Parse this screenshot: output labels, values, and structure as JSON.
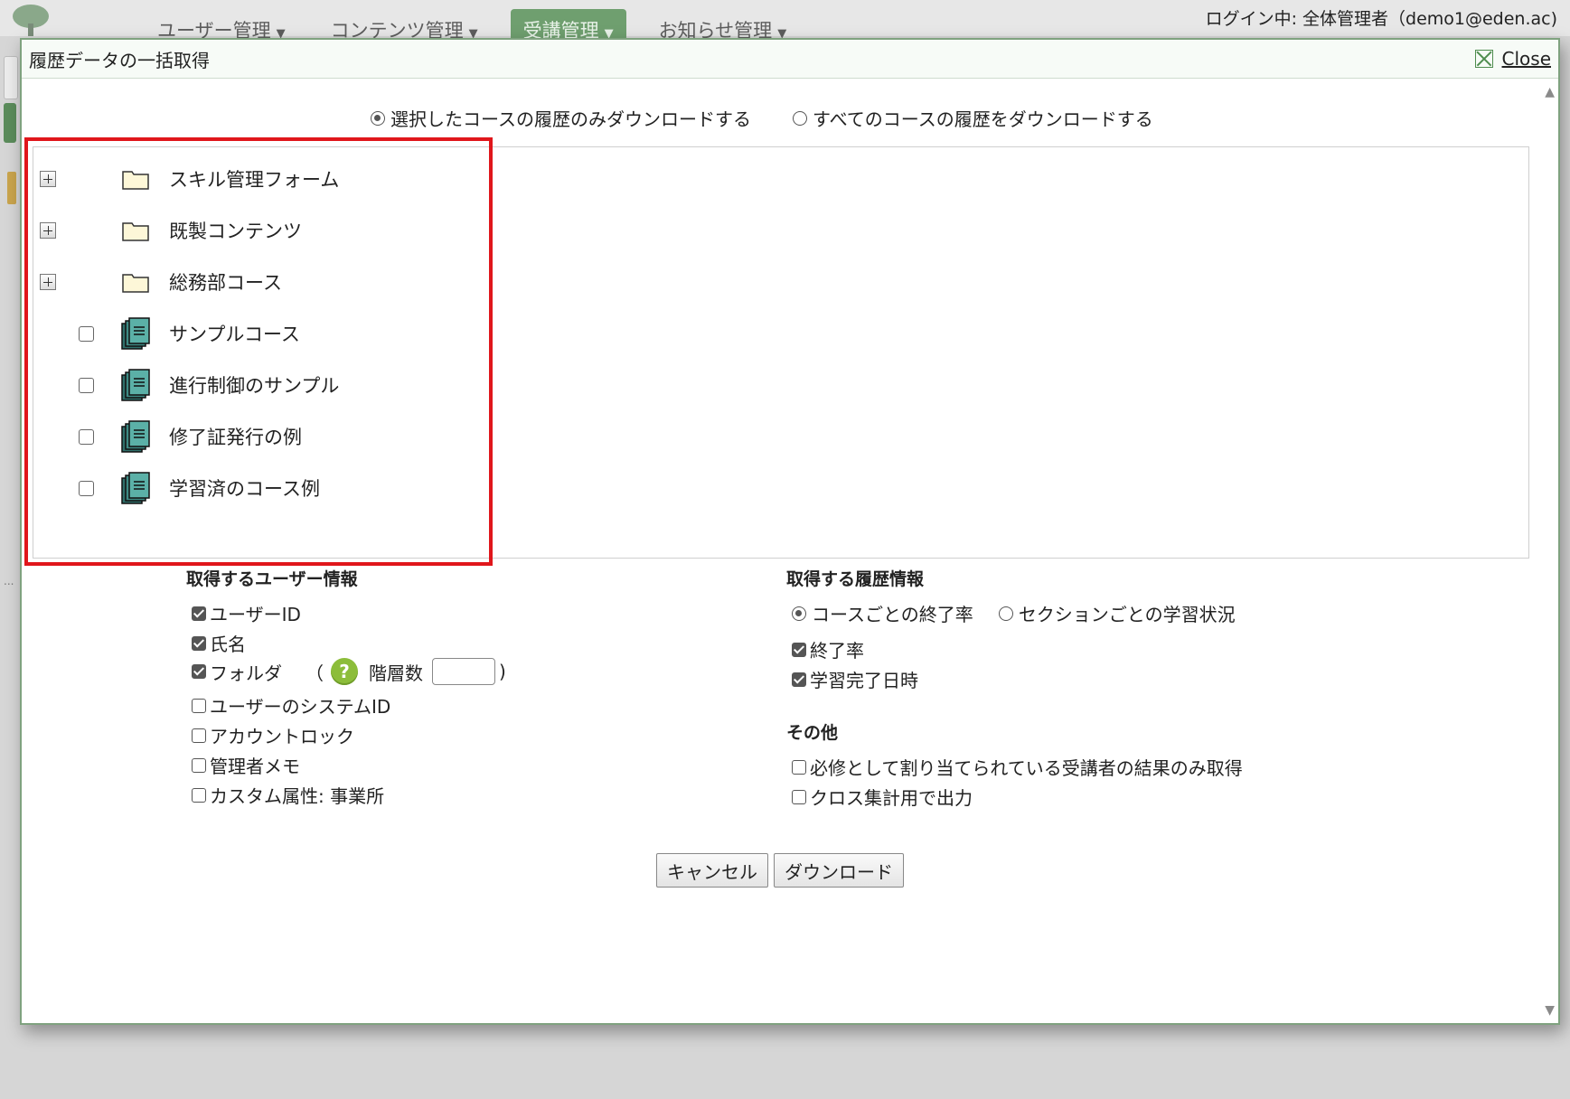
{
  "app": {
    "nav": [
      {
        "label": "ユーザー管理",
        "active": false
      },
      {
        "label": "コンテンツ管理",
        "active": false
      },
      {
        "label": "受講管理",
        "active": true
      },
      {
        "label": "お知らせ管理",
        "active": false
      }
    ],
    "login_status": "ログイン中: 全体管理者（demo1@eden.ac)"
  },
  "modal": {
    "title": "履歴データの一括取得",
    "close_label": "Close",
    "scope": {
      "selected_label": "選択したコースの履歴のみダウンロードする",
      "all_label": "すべてのコースの履歴をダウンロードする",
      "selected": "selected"
    },
    "tree": [
      {
        "type": "folder",
        "label": "スキル管理フォーム"
      },
      {
        "type": "folder",
        "label": "既製コンテンツ"
      },
      {
        "type": "folder",
        "label": "総務部コース"
      },
      {
        "type": "course",
        "label": "サンプルコース",
        "checked": false
      },
      {
        "type": "course",
        "label": "進行制御のサンプル",
        "checked": false
      },
      {
        "type": "course",
        "label": "修了証発行の例",
        "checked": false
      },
      {
        "type": "course",
        "label": "学習済のコース例",
        "checked": false
      }
    ],
    "user_info": {
      "title": "取得するユーザー情報",
      "user_id": {
        "label": "ユーザーID",
        "checked": true
      },
      "name": {
        "label": "氏名",
        "checked": true
      },
      "folder": {
        "label": "フォルダ",
        "checked": true,
        "open_paren": "（",
        "depth_label": "階層数",
        "close_paren": ")",
        "depth_value": ""
      },
      "system_id": {
        "label": "ユーザーのシステムID",
        "checked": false
      },
      "account_lock": {
        "label": "アカウントロック",
        "checked": false
      },
      "admin_memo": {
        "label": "管理者メモ",
        "checked": false
      },
      "custom_attr": {
        "label": "カスタム属性: 事業所",
        "checked": false
      }
    },
    "history_info": {
      "title": "取得する履歴情報",
      "per_course_label": "コースごとの終了率",
      "per_section_label": "セクションごとの学習状況",
      "mode": "per_course",
      "completion_rate": {
        "label": "終了率",
        "checked": true
      },
      "completion_datetime": {
        "label": "学習完了日時",
        "checked": true
      }
    },
    "other": {
      "title": "その他",
      "required_only": {
        "label": "必修として割り当てられている受講者の結果のみ取得",
        "checked": false
      },
      "crosstab": {
        "label": "クロス集計用で出力",
        "checked": false
      }
    },
    "buttons": {
      "cancel": "キャンセル",
      "download": "ダウンロード"
    },
    "colors": {
      "accent": "#7fa27f",
      "highlight": "#e0161b",
      "help": "#8cbd3a"
    }
  }
}
